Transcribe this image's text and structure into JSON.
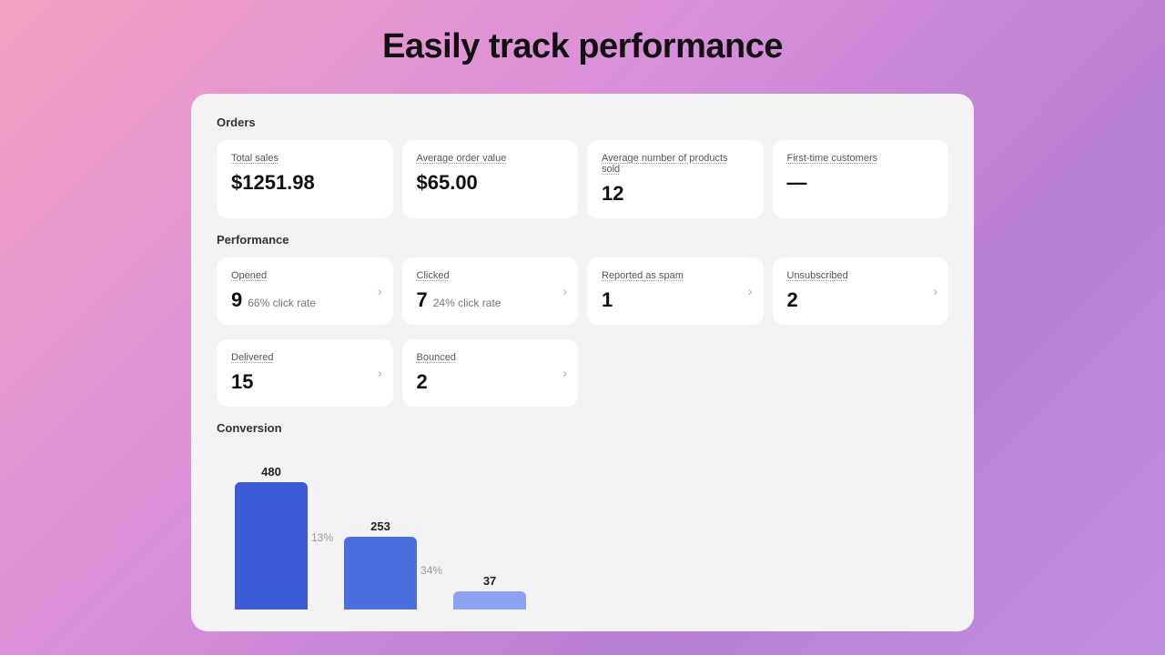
{
  "page": {
    "title": "Easily track performance"
  },
  "orders": {
    "section_label": "Orders",
    "metrics": [
      {
        "id": "total-sales",
        "title": "Total sales",
        "value": "$1251.98",
        "sub": null,
        "has_chevron": false
      },
      {
        "id": "avg-order-value",
        "title": "Average order value",
        "value": "$65.00",
        "sub": null,
        "has_chevron": false
      },
      {
        "id": "avg-products-sold",
        "title": "Average number of products sold",
        "value": "12",
        "sub": null,
        "has_chevron": false
      },
      {
        "id": "first-time-customers",
        "title": "First-time customers",
        "value": "—",
        "sub": null,
        "has_chevron": false
      }
    ]
  },
  "performance": {
    "section_label": "Performance",
    "row1": [
      {
        "id": "opened",
        "title": "Opened",
        "value": "9",
        "sub": "66% click rate",
        "has_chevron": true
      },
      {
        "id": "clicked",
        "title": "Clicked",
        "value": "7",
        "sub": "24% click rate",
        "has_chevron": true
      },
      {
        "id": "reported-spam",
        "title": "Reported as spam",
        "value": "1",
        "sub": null,
        "has_chevron": true
      },
      {
        "id": "unsubscribed",
        "title": "Unsubscribed",
        "value": "2",
        "sub": null,
        "has_chevron": true
      }
    ],
    "row2": [
      {
        "id": "delivered",
        "title": "Delivered",
        "value": "15",
        "sub": null,
        "has_chevron": true
      },
      {
        "id": "bounced",
        "title": "Bounced",
        "value": "2",
        "sub": null,
        "has_chevron": true
      }
    ]
  },
  "conversion": {
    "section_label": "Conversion",
    "bars": [
      {
        "id": "bar-480",
        "value": 480,
        "label": "480",
        "height_pct": 100,
        "color": "dark",
        "percentage_label": "13%",
        "pct_offset_right": true
      },
      {
        "id": "bar-253",
        "value": 253,
        "label": "253",
        "height_pct": 53,
        "color": "medium",
        "percentage_label": "34%",
        "pct_offset_right": true
      },
      {
        "id": "bar-37",
        "value": 37,
        "label": "37",
        "height_pct": 12,
        "color": "light",
        "percentage_label": null
      }
    ]
  }
}
